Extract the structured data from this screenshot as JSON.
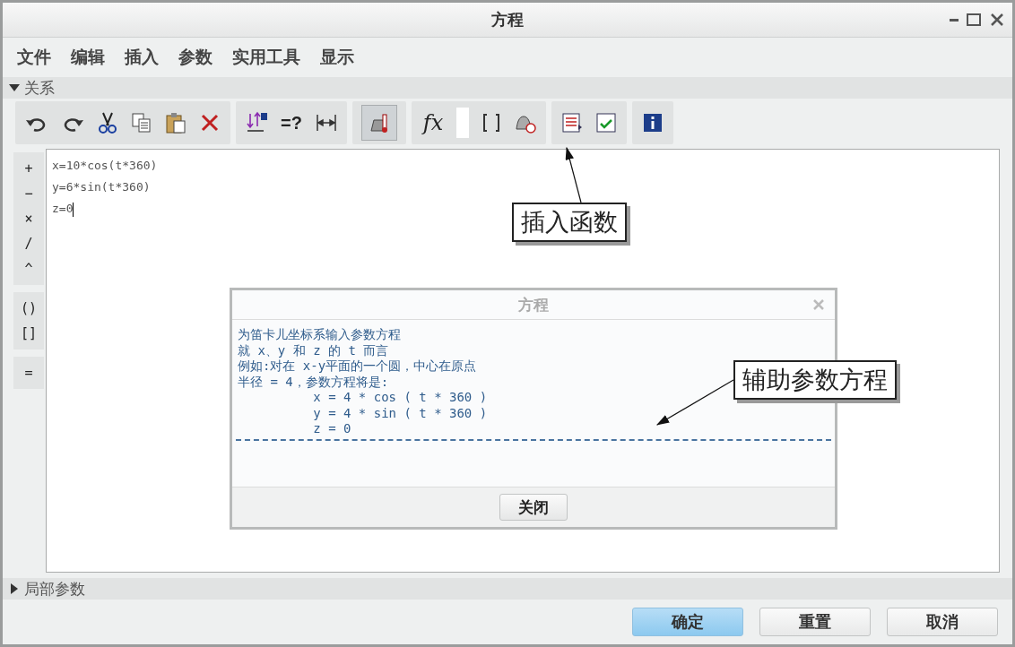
{
  "window": {
    "title": "方程"
  },
  "menu": [
    "文件",
    "编辑",
    "插入",
    "参数",
    "实用工具",
    "显示"
  ],
  "relations_section": {
    "label": "关系",
    "expanded": true
  },
  "toolbar": {
    "evaluate_label": "=?",
    "function_label": "fx"
  },
  "palette": [
    [
      "+",
      "−",
      "×",
      "/",
      "^"
    ],
    [
      "()",
      "[]"
    ],
    [
      "="
    ]
  ],
  "editor": {
    "lines": [
      "x=10*cos(t*360)",
      "y=6*sin(t*360)",
      "z=0"
    ]
  },
  "help_dialog": {
    "title": "方程",
    "lines": [
      "为笛卡儿坐标系输入参数方程",
      "就 x、y 和 z 的 t 而言",
      "例如:对在 x-y平面的一个圆，中心在原点",
      "半径 = 4，参数方程将是:",
      "          x = 4 * cos ( t * 360 )",
      "          y = 4 * sin ( t * 360 )",
      "          z = 0"
    ],
    "close_button": "关闭"
  },
  "callouts": [
    "插入函数",
    "辅助参数方程"
  ],
  "local_params_section": {
    "label": "局部参数",
    "expanded": false
  },
  "buttons": [
    {
      "label": "确定",
      "default": true
    },
    {
      "label": "重置",
      "default": false
    },
    {
      "label": "取消",
      "default": false
    }
  ]
}
